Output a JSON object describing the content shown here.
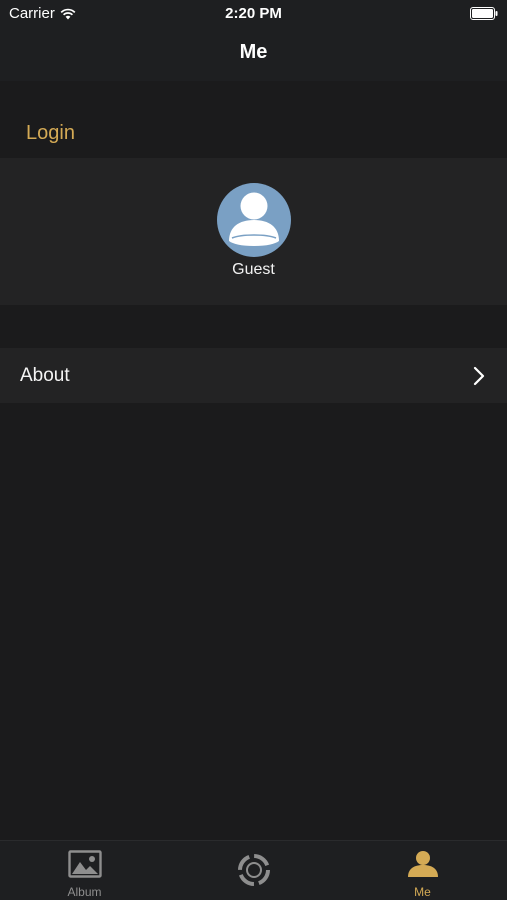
{
  "status_bar": {
    "carrier": "Carrier",
    "time": "2:20 PM",
    "icons": [
      "wifi-icon",
      "battery-icon"
    ]
  },
  "nav": {
    "title": "Me"
  },
  "login_section": {
    "title": "Login",
    "profile": {
      "name": "Guest",
      "avatar_icon": "user-avatar-icon"
    }
  },
  "about_row": {
    "label": "About",
    "icon": "chevron-right-icon"
  },
  "tab_bar": {
    "tabs": [
      {
        "label": "Album",
        "icon": "image-icon",
        "active": false
      },
      {
        "label": "",
        "icon": "camera-360-icon",
        "active": false
      },
      {
        "label": "Me",
        "icon": "person-icon",
        "active": true
      }
    ]
  },
  "colors": {
    "background": "#1b1b1c",
    "card": "#232324",
    "bar": "#1e1f21",
    "accent": "#d4aa55",
    "avatar": "#7aa0c4",
    "inactive": "#8e8e8e"
  }
}
